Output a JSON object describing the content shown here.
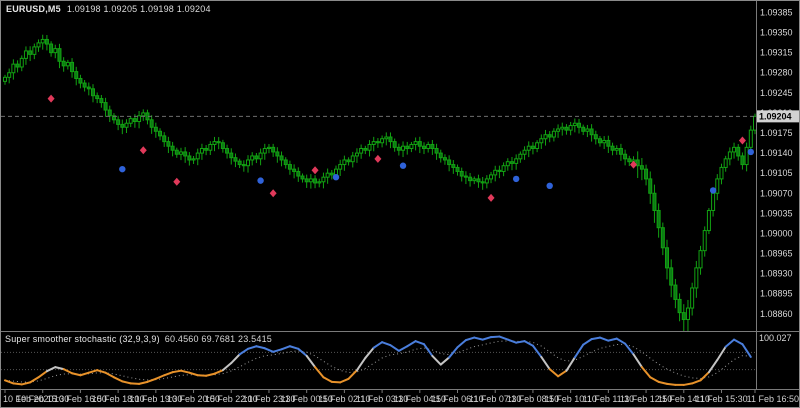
{
  "window": {
    "symbol_period": "EURUSD,M5",
    "ohlc_text": "1.09198 1.09205 1.09198 1.09204"
  },
  "colors": {
    "background": "#000000",
    "candle": "#12a312",
    "candle_fill": "#0c7a14",
    "red_diamond": "#e0395a",
    "blue_dot": "#2f62d9",
    "stoch_gray": "#c4c4c4",
    "stoch_orange": "#e8922a",
    "stoch_blue": "#4a7edc",
    "signal_dotted": "#9a9a9a",
    "level_dotted": "#555555",
    "axis_text": "#d8d8d8",
    "divider": "#7a7a7a",
    "price_line": "#6e6e6e",
    "badge_bg": "#d2d2d2",
    "badge_text": "#000000"
  },
  "chart_data": {
    "type": "candlestick+oscillator",
    "title": "EURUSD M5 with Super smoother stochastic",
    "price_axis": {
      "view_high": 1.09405,
      "view_low": 1.0883,
      "step": 0.00035,
      "labels": [
        "1.09385",
        "1.09350",
        "1.09315",
        "1.09280",
        "1.09245",
        "1.09210",
        "1.09175",
        "1.09140",
        "1.09105",
        "1.09070",
        "1.09035",
        "1.09000",
        "1.08965",
        "1.08930",
        "1.08895",
        "1.08860"
      ],
      "current_price": "1.09204"
    },
    "time_axis": {
      "labels": [
        "10 Feb 2020",
        "10 Feb 15:30",
        "10 Feb 16:50",
        "10 Feb 18:10",
        "10 Feb 19:30",
        "10 Feb 20:50",
        "10 Feb 22:10",
        "10 Feb 23:30",
        "11 Feb 00:50",
        "11 Feb 02:10",
        "11 Feb 03:30",
        "11 Feb 04:50",
        "11 Feb 06:10",
        "11 Feb 07:30",
        "11 Feb 08:50",
        "11 Feb 10:10",
        "11 Feb 11:30",
        "11 Feb 12:50",
        "11 Feb 14:10",
        "11 Feb 15:30",
        "11 Feb 16:50"
      ],
      "candles_per_label": 9
    },
    "candles": {
      "first_open": 1.09265,
      "closes": [
        1.09272,
        1.0928,
        1.09295,
        1.0929,
        1.09305,
        1.09318,
        1.09312,
        1.09325,
        1.09332,
        1.09338,
        1.0933,
        1.09315,
        1.09322,
        1.093,
        1.09292,
        1.09298,
        1.09282,
        1.0927,
        1.09262,
        1.09255,
        1.09252,
        1.0924,
        1.09235,
        1.09228,
        1.09215,
        1.09205,
        1.09198,
        1.0919,
        1.09185,
        1.09192,
        1.092,
        1.09195,
        1.09205,
        1.0921,
        1.09198,
        1.09185,
        1.09178,
        1.0917,
        1.0916,
        1.09152,
        1.09145,
        1.09138,
        1.09142,
        1.09135,
        1.09128,
        1.0913,
        1.0914,
        1.09148,
        1.09145,
        1.09155,
        1.0916,
        1.09158,
        1.09148,
        1.0914,
        1.09132,
        1.09126,
        1.0912,
        1.09118,
        1.09128,
        1.09135,
        1.0913,
        1.0914,
        1.09148,
        1.0915,
        1.09142,
        1.09135,
        1.09128,
        1.0912,
        1.09112,
        1.09108,
        1.091,
        1.09095,
        1.0909,
        1.09095,
        1.09088,
        1.0909,
        1.09098,
        1.09105,
        1.09102,
        1.09112,
        1.0912,
        1.09128,
        1.09125,
        1.09135,
        1.0914,
        1.09148,
        1.09145,
        1.09155,
        1.0916,
        1.09158,
        1.09165,
        1.09168,
        1.0916,
        1.0915,
        1.09145,
        1.09152,
        1.09148,
        1.09155,
        1.0916,
        1.09152,
        1.09148,
        1.09155,
        1.09148,
        1.0914,
        1.09132,
        1.09128,
        1.0912,
        1.09115,
        1.09108,
        1.091,
        1.09098,
        1.09092,
        1.09095,
        1.0909,
        1.09088,
        1.09095,
        1.09102,
        1.0911,
        1.09108,
        1.09118,
        1.09125,
        1.09122,
        1.0913,
        1.09138,
        1.09145,
        1.09152,
        1.09148,
        1.09158,
        1.09165,
        1.09172,
        1.09168,
        1.09178,
        1.09182,
        1.09185,
        1.0918,
        1.09188,
        1.09192,
        1.09185,
        1.09178,
        1.09182,
        1.09172,
        1.09165,
        1.09158,
        1.09162,
        1.09152,
        1.09145,
        1.09148,
        1.09138,
        1.0913,
        1.09125,
        1.09128,
        1.09118,
        1.09112,
        1.09095,
        1.0907,
        1.0904,
        1.0901,
        1.08975,
        1.0894,
        1.0891,
        1.08885,
        1.08862,
        1.0885,
        1.0887,
        1.08905,
        1.0894,
        1.0897,
        1.09005,
        1.0904,
        1.0907,
        1.09095,
        1.09115,
        1.0913,
        1.09142,
        1.0915,
        1.09135,
        1.0912,
        1.0915,
        1.0918,
        1.09204
      ]
    },
    "markers": {
      "red_diamonds": [
        [
          11,
          1.09235
        ],
        [
          33,
          1.09145
        ],
        [
          41,
          1.0909
        ],
        [
          64,
          1.0907
        ],
        [
          74,
          1.0911
        ],
        [
          89,
          1.0913
        ],
        [
          116,
          1.09062
        ],
        [
          150,
          1.0912
        ],
        [
          176,
          1.09162
        ]
      ],
      "blue_dots": [
        [
          28,
          1.09112
        ],
        [
          61,
          1.09092
        ],
        [
          79,
          1.09098
        ],
        [
          95,
          1.09118
        ],
        [
          122,
          1.09095
        ],
        [
          130,
          1.09083
        ],
        [
          169,
          1.09075
        ],
        [
          178,
          1.09142
        ]
      ]
    },
    "indicator": {
      "name": "Super smoother stochastic (32,9,3,9)",
      "values_text": "60.4560 69.7681 23.5415",
      "scale_top_label": "100.027",
      "range": [
        -5,
        105
      ],
      "levels": [
        33,
        67
      ],
      "upper_threshold": 67,
      "lower_threshold": 33,
      "x_step_candles": 2,
      "values": [
        12,
        6,
        4,
        8,
        18,
        30,
        38,
        34,
        26,
        22,
        27,
        32,
        27,
        18,
        10,
        6,
        5,
        9,
        15,
        22,
        28,
        31,
        27,
        22,
        21,
        25,
        32,
        46,
        63,
        74,
        79,
        75,
        68,
        73,
        79,
        74,
        60,
        38,
        18,
        9,
        8,
        15,
        32,
        56,
        76,
        87,
        81,
        70,
        79,
        89,
        83,
        60,
        43,
        57,
        77,
        91,
        96,
        92,
        97,
        98,
        92,
        86,
        89,
        80,
        58,
        34,
        20,
        31,
        57,
        82,
        93,
        96,
        90,
        94,
        84,
        63,
        38,
        18,
        9,
        5,
        3,
        3,
        6,
        12,
        28,
        52,
        78,
        92,
        83,
        58
      ]
    }
  }
}
